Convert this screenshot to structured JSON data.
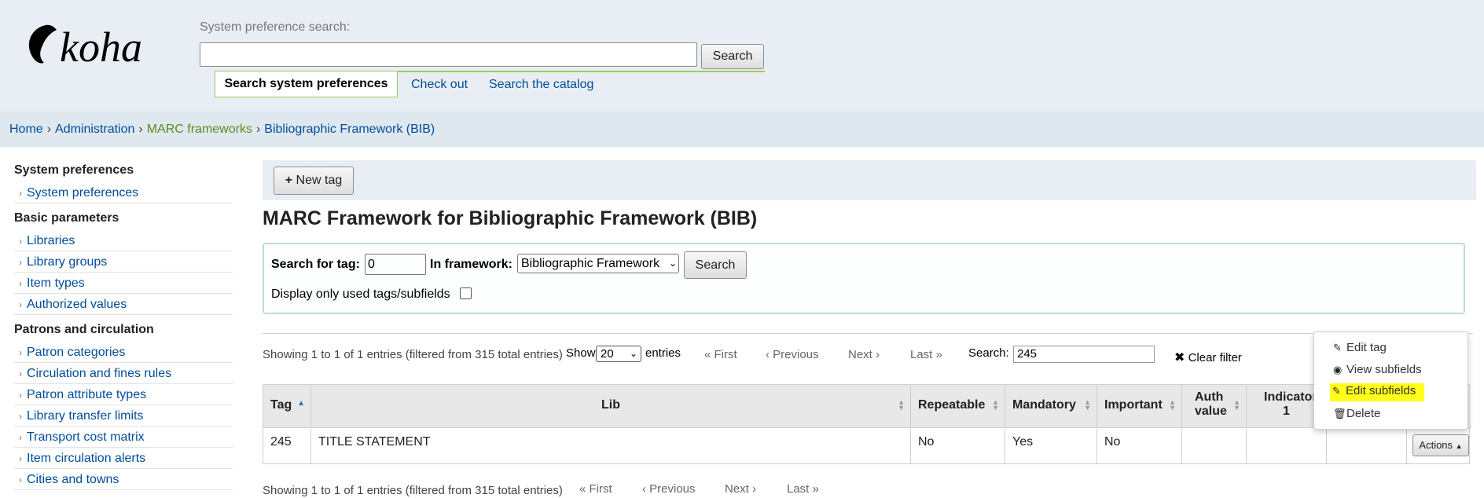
{
  "header": {
    "logo_text": "koha",
    "search_label": "System preference search:",
    "search_value": "",
    "search_button": "Search",
    "tabs": [
      {
        "label": "Search system preferences"
      },
      {
        "label": "Check out"
      },
      {
        "label": "Search the catalog"
      }
    ]
  },
  "breadcrumb": [
    {
      "label": "Home"
    },
    {
      "label": "Administration"
    },
    {
      "label": "MARC frameworks"
    },
    {
      "label": "Bibliographic Framework (BIB)"
    }
  ],
  "sidebar": {
    "sections": [
      {
        "title": "System preferences",
        "items": [
          "System preferences"
        ]
      },
      {
        "title": "Basic parameters",
        "items": [
          "Libraries",
          "Library groups",
          "Item types",
          "Authorized values"
        ]
      },
      {
        "title": "Patrons and circulation",
        "items": [
          "Patron categories",
          "Circulation and fines rules",
          "Patron attribute types",
          "Library transfer limits",
          "Transport cost matrix",
          "Item circulation alerts",
          "Cities and towns"
        ]
      }
    ]
  },
  "toolbar": {
    "new_tag_label": "New tag"
  },
  "page_title": "MARC Framework for Bibliographic Framework (BIB)",
  "filter": {
    "search_for_tag_label": "Search for tag:",
    "tag_value": "0",
    "in_framework_label": "In framework:",
    "framework_value": "Bibliographic Framework",
    "search_button": "Search",
    "only_used_label": "Display only used tags/subfields"
  },
  "pager": {
    "info": "Showing 1 to 1 of 1 entries (filtered from 315 total entries)",
    "show_label": "Show",
    "length_value": "20",
    "entries_label": "entries",
    "first": "« First",
    "previous": "‹ Previous",
    "next": "Next ›",
    "last": "Last »",
    "search_label": "Search:",
    "search_value": "245",
    "clear_filter": "Clear filter"
  },
  "table": {
    "headers": [
      "Tag",
      "Lib",
      "Repeatable",
      "Mandatory",
      "Important",
      "Auth value",
      "Indicator 1"
    ],
    "rows": [
      {
        "tag": "245",
        "lib": "TITLE STATEMENT",
        "repeatable": "No",
        "mandatory": "Yes",
        "important": "No",
        "auth_value": "",
        "indicator1": ""
      }
    ],
    "actions_label": "Actions"
  },
  "dropdown": {
    "items": [
      "Edit tag",
      "View subfields",
      "Edit subfields",
      "Delete"
    ],
    "highlight_color": "#ffff1a"
  },
  "colors": {
    "link": "#004d99",
    "green_link": "#5a8a1c",
    "header_bg": "#e8eef3",
    "accent_tab": "#9ccc5a"
  }
}
